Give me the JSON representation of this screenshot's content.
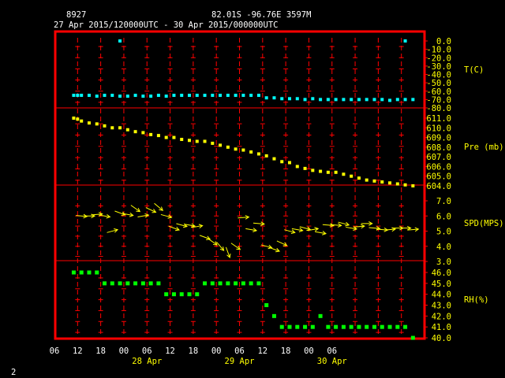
{
  "header": {
    "station": "8927",
    "location": "82.01S   -96.76E   3597M",
    "period": "27 Apr 2015/120000UTC - 30 Apr 2015/000000UTC"
  },
  "footer": {
    "page_number": "2"
  },
  "colors": {
    "frame": "#ff0000",
    "grid": "#ff0000",
    "axis_text": "#ffff00",
    "header_text": "#ffffff",
    "temperature": "#00ffff",
    "pressure": "#ffff00",
    "wind": "#ffff00",
    "humidity": "#00ff00"
  },
  "chart_data": {
    "type": "scatter",
    "x_axis": {
      "tick_labels": [
        "06",
        "12",
        "18",
        "00",
        "06",
        "12",
        "18",
        "00",
        "06",
        "12",
        "18",
        "00",
        "06"
      ],
      "day_labels": [
        "28 Apr",
        "29 Apr",
        "30 Apr"
      ]
    },
    "panels": [
      {
        "name": "T(C)",
        "y_ticks": [
          "0.0",
          "-10.0",
          "-20.0",
          "-30.0",
          "-40.0",
          "-50.0",
          "-60.0",
          "-70.0",
          "-80.0"
        ],
        "ylim": [
          -80,
          0
        ],
        "x": [
          -19,
          -18,
          -17,
          -15,
          -13,
          -11,
          -9,
          -7,
          -5,
          -3,
          -1,
          1,
          3,
          5,
          7,
          9,
          11,
          13,
          15,
          17,
          19,
          21,
          23,
          25,
          27,
          29,
          31,
          33,
          35,
          37,
          39,
          41,
          43,
          45,
          47,
          49,
          51,
          53,
          55,
          57,
          59,
          61,
          63,
          65,
          67,
          69
        ],
        "values": [
          -65,
          -65,
          -65,
          -65,
          -66,
          -65,
          -65,
          -66,
          -66,
          -65,
          -66,
          -66,
          -65,
          -66,
          -65,
          -65,
          -65,
          -65,
          -65,
          -65,
          -65,
          -65,
          -65,
          -65,
          -65,
          -65,
          -68,
          -68,
          -69,
          -69,
          -69,
          -70,
          -69,
          -70,
          -70,
          -70,
          -70,
          -70,
          -70,
          -70,
          -70,
          -70,
          -71,
          -70,
          -70,
          -70
        ],
        "outliers": [
          {
            "x": -7,
            "value": 0
          },
          {
            "x": 67,
            "value": 0
          }
        ]
      },
      {
        "name": "Pre (mb)",
        "y_ticks": [
          "611.0",
          "610.0",
          "609.0",
          "608.0",
          "607.0",
          "606.0",
          "605.0",
          "604.0"
        ],
        "ylim": [
          604,
          611
        ],
        "x": [
          -19,
          -18,
          -17,
          -15,
          -13,
          -11,
          -9,
          -7,
          -5,
          -3,
          -1,
          1,
          3,
          5,
          7,
          9,
          11,
          13,
          15,
          17,
          19,
          21,
          23,
          25,
          27,
          29,
          31,
          33,
          35,
          37,
          39,
          41,
          43,
          45,
          47,
          49,
          51,
          53,
          55,
          57,
          59,
          61,
          63,
          65,
          67,
          69
        ],
        "values": [
          611.0,
          610.9,
          610.7,
          610.5,
          610.4,
          610.2,
          610.0,
          610.0,
          609.8,
          609.6,
          609.5,
          609.3,
          609.2,
          609.0,
          609.0,
          608.8,
          608.7,
          608.6,
          608.6,
          608.4,
          608.2,
          608.0,
          607.8,
          607.7,
          607.5,
          607.3,
          607.1,
          606.8,
          606.5,
          606.4,
          606.0,
          605.8,
          605.6,
          605.5,
          605.4,
          605.4,
          605.2,
          605.0,
          604.8,
          604.6,
          604.5,
          604.4,
          604.3,
          604.2,
          604.1,
          604.0
        ]
      },
      {
        "name": "SPD(MPS)",
        "y_ticks": [
          "7.0",
          "6.0",
          "5.0",
          "4.0",
          "3.0"
        ],
        "ylim": [
          3,
          7
        ],
        "x": [
          -17,
          -15,
          -13,
          -11,
          -9,
          -7,
          -5,
          -3,
          -1,
          1,
          3,
          5,
          7,
          9,
          11,
          13,
          15,
          17,
          19,
          21,
          23,
          25,
          27,
          29,
          31,
          33,
          35,
          37,
          39,
          41,
          43,
          45,
          47,
          49,
          51,
          53,
          55,
          57,
          59,
          61,
          63,
          65,
          67,
          69
        ],
        "values": [
          6.0,
          6.0,
          6.1,
          6.0,
          5.0,
          6.2,
          6.1,
          6.5,
          6.0,
          6.4,
          6.6,
          6.0,
          5.2,
          5.4,
          5.4,
          5.3,
          4.6,
          4.3,
          4.0,
          3.6,
          4.0,
          5.9,
          5.1,
          5.5,
          4.0,
          3.8,
          4.2,
          5.0,
          5.1,
          5.2,
          5.1,
          4.9,
          5.4,
          5.4,
          5.5,
          5.2,
          5.3,
          5.5,
          5.2,
          5.1,
          5.1,
          5.2,
          5.2,
          5.1
        ],
        "direction": [
          5,
          0,
          -5,
          10,
          -15,
          20,
          10,
          35,
          -10,
          25,
          40,
          15,
          20,
          15,
          10,
          -10,
          20,
          35,
          50,
          70,
          35,
          -5,
          10,
          5,
          15,
          20,
          25,
          15,
          10,
          15,
          -10,
          10,
          5,
          5,
          15,
          10,
          -5,
          0,
          5,
          5,
          -5,
          0,
          0,
          -5
        ]
      },
      {
        "name": "RH(%)",
        "y_ticks": [
          "46.0",
          "45.0",
          "44.0",
          "43.0",
          "42.0",
          "41.0",
          "40.0"
        ],
        "ylim": [
          40,
          46
        ],
        "x": [
          -19,
          -17,
          -15,
          -13,
          -11,
          -9,
          -7,
          -5,
          -3,
          -1,
          1,
          3,
          5,
          7,
          9,
          11,
          13,
          15,
          17,
          19,
          21,
          23,
          25,
          27,
          29,
          31,
          33,
          35,
          37,
          39,
          41,
          43,
          45,
          47,
          49,
          51,
          53,
          55,
          57,
          59,
          61,
          63,
          65,
          67,
          69
        ],
        "values": [
          46,
          46,
          46,
          46,
          45,
          45,
          45,
          45,
          45,
          45,
          45,
          45,
          44,
          44,
          44,
          44,
          44,
          45,
          45,
          45,
          45,
          45,
          45,
          45,
          45,
          43,
          42,
          41,
          41,
          41,
          41,
          41,
          42,
          41,
          41,
          41,
          41,
          41,
          41,
          41,
          41,
          41,
          41,
          41,
          40
        ]
      }
    ]
  }
}
